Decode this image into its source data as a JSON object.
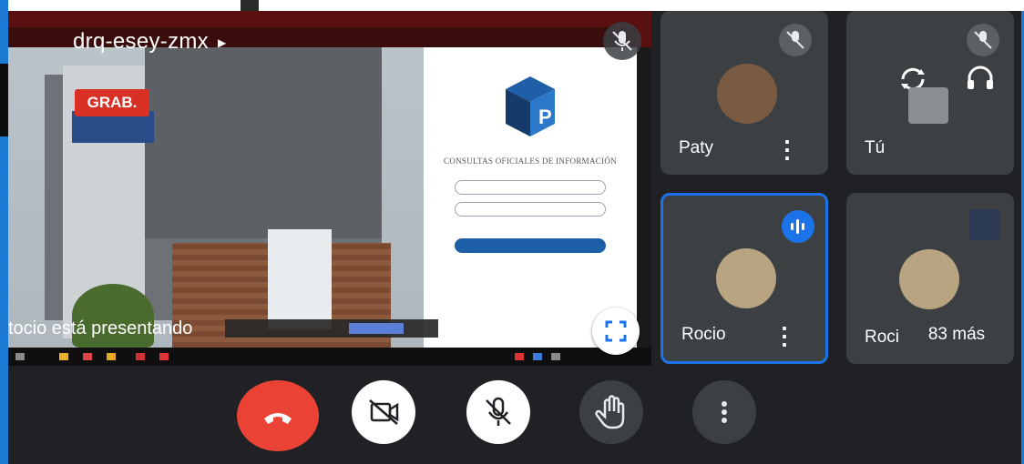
{
  "meeting": {
    "code": "drq-esey-zmx",
    "recording_badge": "GRAB.",
    "presenter_label": "tocio está presentando"
  },
  "presentation": {
    "login_title": "CONSULTAS OFICIALES DE INFORMACIÓN"
  },
  "participants": [
    {
      "name": "Paty"
    },
    {
      "name": "Tú"
    },
    {
      "name": "Rocio"
    },
    {
      "name": "Roci"
    }
  ],
  "overflow_label": "83 más",
  "colors": {
    "hangup": "#ea4335",
    "accent": "#1a73e8",
    "recording": "#d93025",
    "tile": "#3c4043",
    "background": "#202124"
  },
  "icons": {
    "hangup": "phone-hangup-icon",
    "camera": "camera-off-icon",
    "mic": "mic-off-icon",
    "hand": "raise-hand-icon",
    "more": "more-vert-icon",
    "fullscreen": "fullscreen-icon",
    "speaking": "audio-wave-icon",
    "switch_camera": "switch-camera-icon",
    "headphones": "headphones-icon"
  }
}
